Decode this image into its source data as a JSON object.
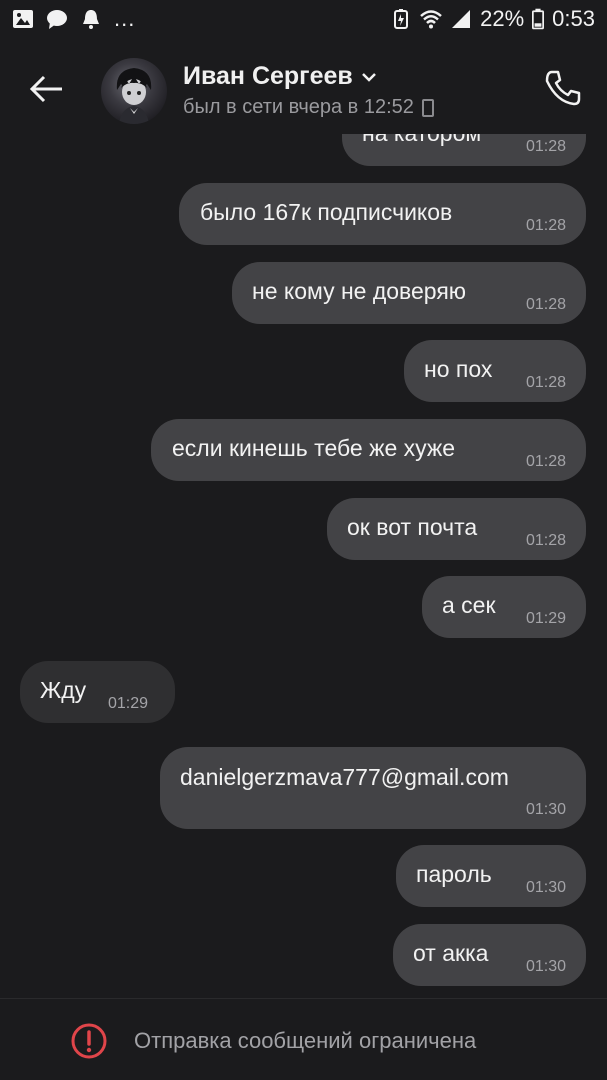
{
  "status_bar": {
    "battery": "22%",
    "time": "0:53",
    "overflow": "..."
  },
  "header": {
    "name": "Иван Сергеев",
    "last_seen": "был в сети вчера в 12:52"
  },
  "messages": [
    {
      "dir": "out",
      "text": "на катором",
      "time": "01:28"
    },
    {
      "dir": "out",
      "text": "было 167к подписчиков",
      "time": "01:28"
    },
    {
      "dir": "out",
      "text": "не кому не доверяю",
      "time": "01:28"
    },
    {
      "dir": "out",
      "text": "но пох",
      "time": "01:28"
    },
    {
      "dir": "out",
      "text": "если кинешь тебе же хуже",
      "time": "01:28"
    },
    {
      "dir": "out",
      "text": "ок вот почта",
      "time": "01:28"
    },
    {
      "dir": "out",
      "text": "а сек",
      "time": "01:29"
    },
    {
      "dir": "in",
      "text": "Жду",
      "time": "01:29"
    },
    {
      "dir": "out",
      "text": "danielgerzmava777@gmail.com",
      "time": "01:30"
    },
    {
      "dir": "out",
      "text": "пароль",
      "time": "01:30"
    },
    {
      "dir": "out",
      "text": "от акка",
      "time": "01:30"
    }
  ],
  "footer": {
    "restriction_text": "Отправка сообщений ограничена"
  },
  "colors": {
    "background": "#1b1b1d",
    "bubble_out": "#434346",
    "bubble_in": "#2f2f31",
    "link": "#6aa2e6",
    "warning": "#e0454a"
  }
}
